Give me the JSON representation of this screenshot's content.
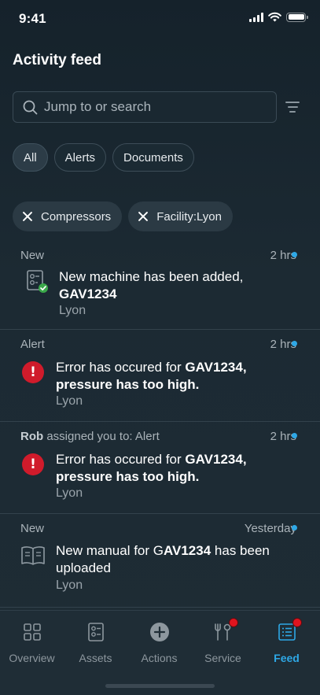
{
  "status_bar": {
    "time": "9:41"
  },
  "header": {
    "title": "Activity feed"
  },
  "search": {
    "placeholder": "Jump to or search"
  },
  "chips": [
    {
      "label": "All",
      "active": true
    },
    {
      "label": "Alerts",
      "active": false
    },
    {
      "label": "Documents",
      "active": false
    }
  ],
  "active_filters": [
    {
      "label": "Compressors"
    },
    {
      "label": "Facility:Lyon"
    }
  ],
  "feed": [
    {
      "category": "New",
      "time": "2 hrs",
      "icon": "machine-added-icon",
      "text_plain": "New machine has been added,",
      "text_bold": "GAV1234",
      "location": "Lyon"
    },
    {
      "category": "Alert",
      "time": "2 hrs",
      "icon": "error-icon",
      "text_plain": "Error has occured for",
      "text_bold": "GAV1234,",
      "text_bold_2": "pressure has too high.",
      "location": "Lyon"
    },
    {
      "assigner": "Rob",
      "category_suffix": "assigned you to: Alert",
      "time": "2 hrs",
      "icon": "error-icon",
      "text_plain": "Error has occured for",
      "text_bold": "GAV1234,",
      "text_bold_2": "pressure has too high.",
      "location": "Lyon"
    },
    {
      "category": "New",
      "time": "Yesterday",
      "icon": "manual-book-icon",
      "text_plain": "New manual for G",
      "text_bold": "AV1234",
      "text_plain_2": "has been uploaded",
      "location": "Lyon"
    }
  ],
  "tabbar": [
    {
      "label": "Overview",
      "icon": "grid-icon",
      "active": false,
      "badge": false
    },
    {
      "label": "Assets",
      "icon": "asset-icon",
      "active": false,
      "badge": false
    },
    {
      "label": "Actions",
      "icon": "plus-circle-icon",
      "active": false,
      "badge": false
    },
    {
      "label": "Service",
      "icon": "wrench-icon",
      "active": false,
      "badge": true
    },
    {
      "label": "Feed",
      "icon": "feed-icon",
      "active": true,
      "badge": true
    }
  ],
  "colors": {
    "accent": "#2ea8e6",
    "error": "#d01b2b",
    "success": "#3aa84a",
    "badge": "#e0141e"
  }
}
